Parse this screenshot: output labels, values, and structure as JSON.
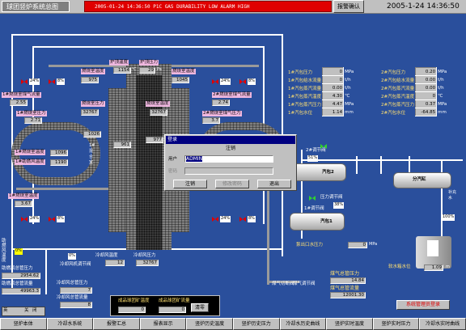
{
  "header": {
    "title": "球团竖炉系统总图",
    "alarm_text": "2005-01-24 14:36:50 P1C   GAS DURABILITY LOW ALARM  HIGH",
    "ack_label": "报警确认",
    "clock": "2005-1-24  14:36:50"
  },
  "stove": {
    "top_temp_label": "炉顶温度",
    "top_temp_value": "1154",
    "top_unit": "℃",
    "top_press_label": "炉顶压力",
    "top_press_value": "29",
    "top_press_unit": "Pa",
    "shaft_temp_label1": "燃烧室温度",
    "shaft_temp_label2": "燃烧室温度",
    "shaft_press_label": "燃烧室压力",
    "shaft_vals": [
      "975",
      "1045",
      "32767",
      "961",
      "32767",
      "977",
      "1026"
    ],
    "left_labels": [
      "1#燃烧室温度",
      "1#燃烧室压力",
      "1#助燃风温度",
      "1#燃烧室温度",
      "1#燃烧室压力"
    ],
    "left_vals": [
      "1096",
      "1190",
      "3.67"
    ],
    "center_label": "1#\n混\n合\n室",
    "right_labels": [
      "2#燃烧室温度",
      "2#燃烧室压力"
    ]
  },
  "left_panel": {
    "gas_label": "1#燃烧室煤气流量",
    "gas_val": "2.55",
    "gas_label2": "1#燃烧室煤气压力",
    "gas_val2": "2.71",
    "valve_pct": [
      "24%",
      "8%",
      "24%",
      "8%"
    ],
    "comb_air_label": "助燃风温度",
    "comb_air_press_label": "助燃风总管压力",
    "comb_air_press_val": "2954.62",
    "comb_air_flow_label": "助燃风总管流量",
    "comb_air_flow_val": "49963.3",
    "cool_fan_label": "冷却风总管压力",
    "cool_fan_val": "7",
    "cool_fan_flow_label": "冷却风总管流量",
    "cool_fan_flow_val": "8",
    "lang": "英",
    "buttons": [
      "关",
      "闭"
    ]
  },
  "right_panel": {
    "gas_label": "2#燃烧室煤气流量",
    "gas_val": "2.74",
    "gas_label2": "2#燃烧室煤气压力",
    "gas_val2": "3.7",
    "valve_pct": [
      "24%",
      "8%",
      "24%",
      "8%"
    ]
  },
  "readings": {
    "left": [
      {
        "name": "1#汽包压力",
        "value": "0",
        "unit": "MPa"
      },
      {
        "name": "1#汽包给水流量",
        "value": "0",
        "unit": "t/h"
      },
      {
        "name": "1#汽包蒸汽流量",
        "value": "0.00",
        "unit": "t/h"
      },
      {
        "name": "1#汽包蒸汽温度",
        "value": "4.30",
        "unit": "℃"
      },
      {
        "name": "1#汽包蒸汽压力",
        "value": "4.47",
        "unit": "MPa"
      },
      {
        "name": "1#汽包水位",
        "value": "1.14",
        "unit": "mm"
      }
    ],
    "right": [
      {
        "name": "2#汽包压力",
        "value": "0.20",
        "unit": "MPa"
      },
      {
        "name": "2#汽包给水流量",
        "value": "0.00",
        "unit": "t/h"
      },
      {
        "name": "2#汽包蒸汽流量",
        "value": "0.00",
        "unit": "t/h"
      },
      {
        "name": "2#汽包蒸汽温度",
        "value": "0",
        "unit": "℃"
      },
      {
        "name": "2#汽包蒸汽压力",
        "value": "0.37",
        "unit": "MPa"
      },
      {
        "name": "2#汽包水位",
        "value": "-64.85",
        "unit": "mm"
      }
    ]
  },
  "drums": {
    "drum2": "汽包2",
    "drum1": "汽包1",
    "steam_header": "分汽缸",
    "reg_valve2": "2#调节阀",
    "reg2_pct": "51%",
    "press_reg": "压力调节阀",
    "press_pct": "38%",
    "reg_valve1": "1#调节阀",
    "reg1_pct": "33%",
    "softwater": "软水箱水位",
    "softwater_val": "1.09",
    "softwater_unit": "m",
    "pump_label": "泵出口水压力",
    "pump_val": "0",
    "pump_unit": "MPa",
    "aux_water": "补充水",
    "aux_pct": "100%"
  },
  "bottom": {
    "gas_total_label": "煤气总管压力",
    "gas_total_val": "14.84",
    "gas_flow_label": "煤气总管流量",
    "gas_flow_val": "12001.30",
    "gas_cut_label": "煤气切断阀",
    "gas_cut_label2": "煤气调节阀",
    "product_temp_label": "成品球团矿温度",
    "product_temp_val": "0",
    "product_flow_label": "成品球团矿流量",
    "product_flow_val": "0",
    "cool_label": "冷却风机调节阀",
    "cool_pct": "0%",
    "fan_label": "冷却风机调节阀",
    "fan_pct": "0%",
    "cool_temp": "冷却风温度",
    "cool_temp_val": "12",
    "cool_press": "冷却风压力",
    "cool_press_val": "32767",
    "alarm_button": "清零",
    "login_label": "系统管理员登录",
    "pct_labels": [
      "0%",
      "0%",
      "0%"
    ]
  },
  "dialog": {
    "title": "登录",
    "header": "注销",
    "user_label": "用户",
    "user_value": "ADMIN",
    "pwd_label": "密码",
    "btn_login": "注销",
    "btn_change": "修改密码",
    "btn_exit": "退出"
  },
  "nav": [
    "竖炉本体",
    "冷却水系统",
    "报警汇总",
    "报表显示",
    "竖炉历史温度",
    "竖炉历史压力",
    "冷却水历史曲线",
    "竖炉实时温度",
    "竖炉实时压力",
    "冷却水实时曲线"
  ]
}
